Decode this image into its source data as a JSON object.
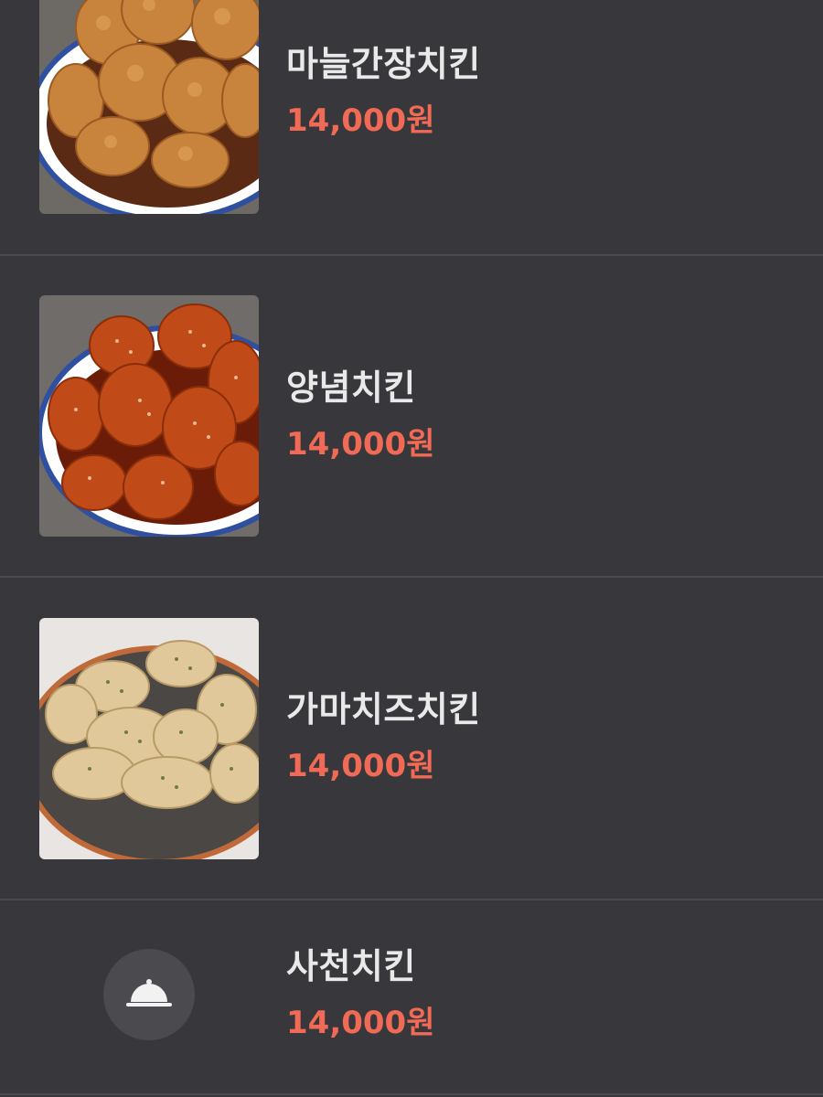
{
  "menu": {
    "items": [
      {
        "name": "마늘간장치킨",
        "price": "14,000원",
        "image_icon": "fried-chicken-photo"
      },
      {
        "name": "양념치킨",
        "price": "14,000원",
        "image_icon": "seasoned-chicken-photo"
      },
      {
        "name": "가마치즈치킨",
        "price": "14,000원",
        "image_icon": "cheese-chicken-photo"
      },
      {
        "name": "사천치킨",
        "price": "14,000원",
        "image_icon": "cloche-icon"
      }
    ]
  },
  "colors": {
    "background": "#38373b",
    "divider": "#4a494e",
    "name_text": "#e9e9ea",
    "price_text": "#f06a55",
    "placeholder_bg": "#4b4a4f"
  }
}
